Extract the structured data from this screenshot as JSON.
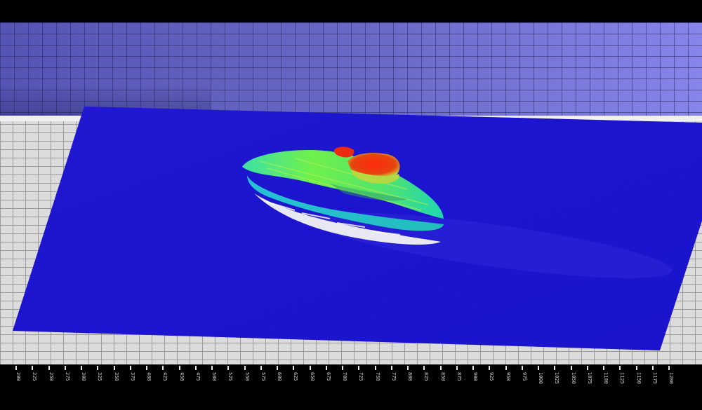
{
  "scene": {
    "description_free": true,
    "colors": {
      "background": "#000000",
      "back_wall": "#6a6ac8",
      "floor": "#dcdcdc",
      "grid_line": "#9a9a9a",
      "seabed": "#1d14d6",
      "target_low": "#27d8c0",
      "target_mid": "#6de84a",
      "target_high": "#e63a1e",
      "shadow": "#f2f2f2"
    },
    "color_ramp": [
      "blue",
      "cyan",
      "green",
      "yellow",
      "red"
    ]
  },
  "axis": {
    "ticks": [
      "200",
      "225",
      "250",
      "275",
      "300",
      "325",
      "350",
      "375",
      "400",
      "425",
      "450",
      "475",
      "500",
      "525",
      "550",
      "575",
      "600",
      "625",
      "650",
      "675",
      "700",
      "725",
      "750",
      "775",
      "800",
      "825",
      "850",
      "875",
      "900",
      "925",
      "950",
      "975",
      "1000",
      "1025",
      "1050",
      "1075",
      "1100",
      "1125",
      "1150",
      "1175",
      "1200"
    ]
  }
}
